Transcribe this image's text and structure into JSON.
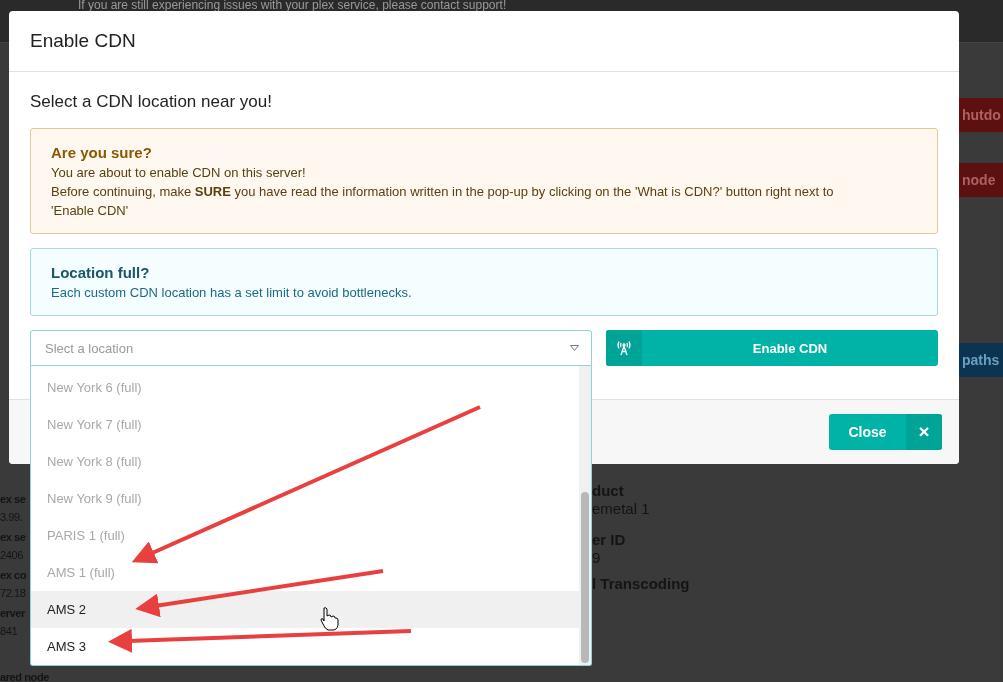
{
  "background": {
    "notice": "If you are still experiencing issues with your plex service, please contact support!",
    "side_buttons": [
      {
        "label": "hutdo",
        "kind": "danger"
      },
      {
        "label": "node",
        "kind": "danger"
      },
      {
        "label": "paths",
        "kind": "info"
      }
    ],
    "left_fields": [
      {
        "label": "ex se",
        "value": "3.99."
      },
      {
        "label": "ex se",
        "value": "2406"
      },
      {
        "label": "ex co",
        "value": "72.18"
      },
      {
        "label": "erver",
        "value": "841"
      },
      {
        "label": "ared node"
      }
    ],
    "right_fields": [
      {
        "label": "duct",
        "value": "emetal 1"
      },
      {
        "label": "er ID",
        "value": "9"
      },
      {
        "label": "l Transcoding"
      }
    ]
  },
  "dialog": {
    "title": "Enable CDN",
    "heading": "Select a CDN location near you!",
    "alerts": [
      {
        "kind": "warning",
        "title": "Are you sure?",
        "lines": [
          "You are about to enable CDN on this server!",
          "Before continuing, make **SURE** you have read the information written in the pop-up by clicking on the 'What is CDN?' button right next to 'Enable CDN'"
        ]
      },
      {
        "kind": "info",
        "title": "Location full?",
        "lines": [
          "Each custom CDN location has a set limit to avoid bottlenecks."
        ]
      }
    ],
    "select": {
      "placeholder": "Slect a location",
      "expanded": true,
      "options": [
        {
          "label": "New York 6 (full)",
          "disabled": true,
          "selected": false
        },
        {
          "label": "New York 7 (full)",
          "disabled": true,
          "selected": false
        },
        {
          "label": "New York 8 (full)",
          "disabled": true,
          "selected": false
        },
        {
          "label": "New York 9 (full)",
          "disabled": true,
          "selected": false
        },
        {
          "label": "PARIS 1 (full)",
          "disabled": true,
          "selected": false
        },
        {
          "label": "AMS 1 (full)",
          "disabled": true,
          "selected": false
        },
        {
          "label": "AMS 2",
          "disabled": false,
          "selected": true
        },
        {
          "label": "AMS 3",
          "disabled": false,
          "selected": false
        }
      ]
    },
    "enable_button": "Enable CDN",
    "close_button": "Close",
    "close_icon": "×"
  }
}
